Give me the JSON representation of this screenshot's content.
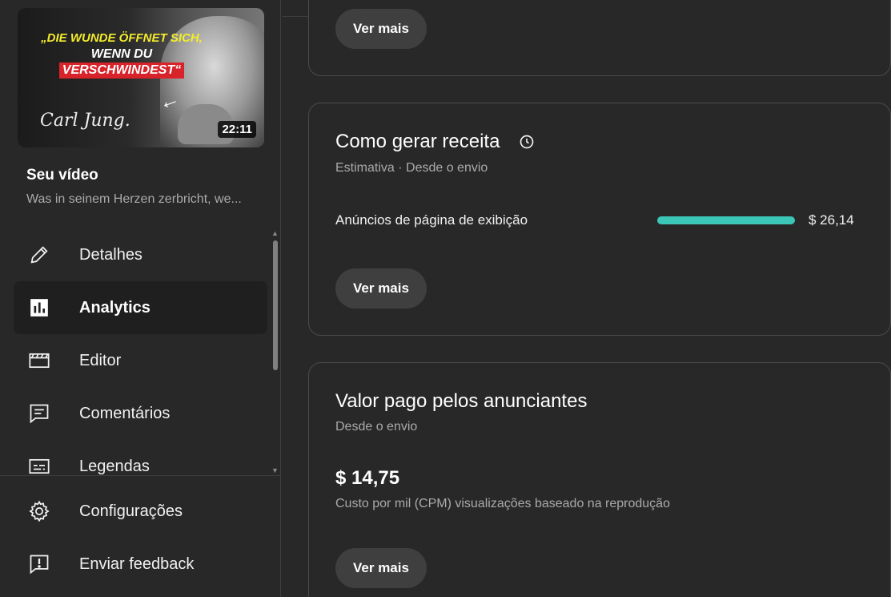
{
  "sidebar": {
    "thumbnail": {
      "headline_line1": "„DIE WUNDE ÖFFNET SICH,",
      "headline_line2": "WENN DU",
      "headline_line3": "VERSCHWINDEST“",
      "signature": "Carl Jung.",
      "duration": "22:11"
    },
    "video_heading": "Seu vídeo",
    "video_title": "Was in seinem Herzen zerbricht, we...",
    "nav_items": [
      {
        "label": "Detalhes",
        "icon": "pencil-icon"
      },
      {
        "label": "Analytics",
        "icon": "analytics-icon",
        "active": true
      },
      {
        "label": "Editor",
        "icon": "clapperboard-icon"
      },
      {
        "label": "Comentários",
        "icon": "comment-icon"
      },
      {
        "label": "Legendas",
        "icon": "subtitles-icon"
      }
    ],
    "footer_items": [
      {
        "label": "Configurações",
        "icon": "gear-icon"
      },
      {
        "label": "Enviar feedback",
        "icon": "feedback-icon"
      }
    ]
  },
  "main": {
    "top_card": {
      "button": "Ver mais"
    },
    "revenue_card": {
      "title": "Como gerar receita",
      "subtitle": "Estimativa · Desde o envio",
      "row_label": "Anúncios de página de exibição",
      "row_value": "$ 26,14",
      "row_fraction": 1.0,
      "button": "Ver mais"
    },
    "cpm_card": {
      "title": "Valor pago pelos anunciantes",
      "subtitle": "Desde o envio",
      "value": "$ 14,75",
      "description": "Custo por mil (CPM) visualizações baseado na reprodução",
      "button": "Ver mais"
    }
  },
  "colors": {
    "background": "#282828",
    "active_nav": "#1f1f1f",
    "bar_accent": "#3cc6b8",
    "button_bg": "#3f3f3f"
  }
}
